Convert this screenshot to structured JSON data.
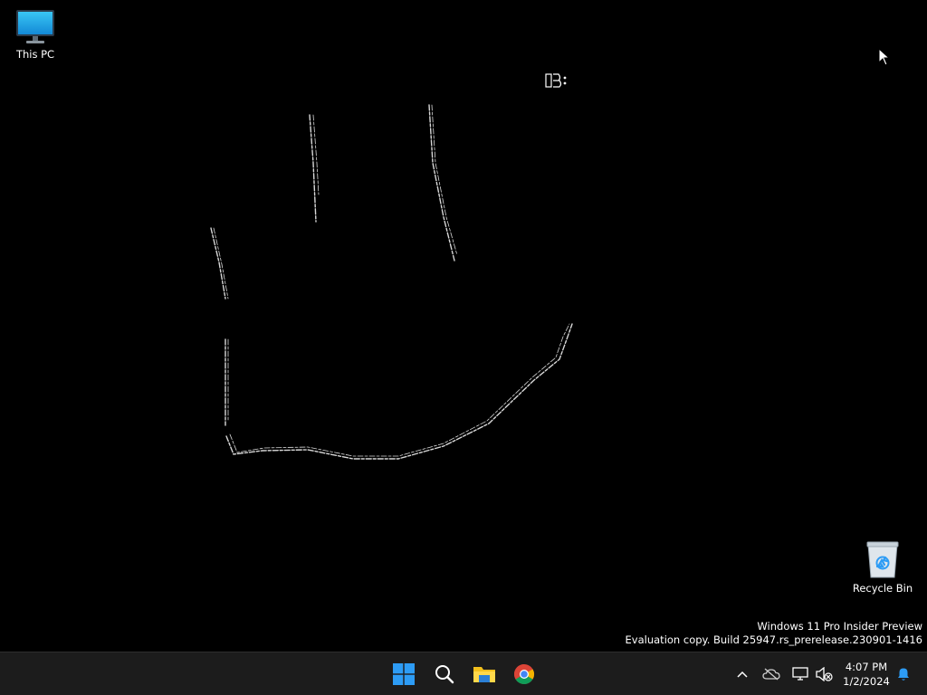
{
  "desktop": {
    "icons": [
      {
        "label": "This PC",
        "icon": "monitor-icon"
      },
      {
        "label": "Recycle Bin",
        "icon": "recycle-bin-icon"
      }
    ],
    "watermark": {
      "line1": "Windows 11 Pro Insider Preview",
      "line2": "Evaluation copy. Build 25947.rs_prerelease.230901-1416"
    }
  },
  "taskbar": {
    "apps": [
      {
        "name": "Start",
        "icon": "windows-logo-icon"
      },
      {
        "name": "Search",
        "icon": "search-icon"
      },
      {
        "name": "File Explorer",
        "icon": "folder-icon"
      },
      {
        "name": "Google Chrome",
        "icon": "chrome-icon"
      }
    ],
    "tray": {
      "icons": [
        "chevron-up-icon",
        "onedrive-icon",
        "network-icon",
        "volume-muted-icon",
        "notification-bell-icon"
      ],
      "time": "4:07 PM",
      "date": "1/2/2024"
    }
  },
  "colors": {
    "desktop_background": "#000000",
    "taskbar_background": "#1c1c1c",
    "accent": "#2d9cf5"
  }
}
